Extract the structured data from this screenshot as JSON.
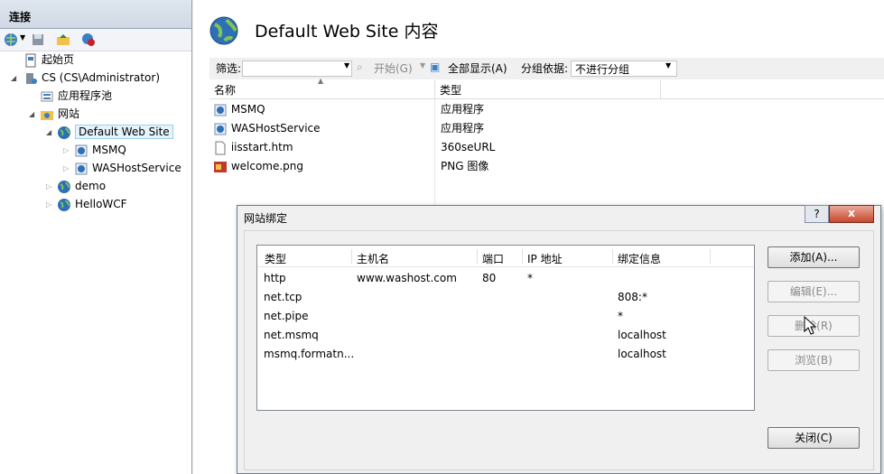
{
  "left": {
    "title": "连接",
    "tree": [
      {
        "label": "起始页",
        "icon": "start-page-icon"
      },
      {
        "label": "CS (CS\\Administrator)",
        "icon": "server-icon"
      },
      {
        "label": "应用程序池",
        "icon": "app-pool-icon"
      },
      {
        "label": "网站",
        "icon": "sites-folder-icon"
      },
      {
        "label": "Default Web Site",
        "icon": "globe-icon"
      },
      {
        "label": "MSMQ",
        "icon": "app-icon"
      },
      {
        "label": "WASHostService",
        "icon": "app-icon"
      },
      {
        "label": "demo",
        "icon": "globe-icon"
      },
      {
        "label": "HelloWCF",
        "icon": "globe-icon"
      }
    ]
  },
  "header": {
    "title": "Default Web Site 内容"
  },
  "filterbar": {
    "filter_label": "筛选:",
    "start_label": "开始(G)",
    "showall_label": "全部显示(A)",
    "groupby_label": "分组依据:",
    "groupby_value": "不进行分组"
  },
  "list": {
    "col_name": "名称",
    "col_type": "类型",
    "rows": [
      {
        "name": "MSMQ",
        "type": "应用程序"
      },
      {
        "name": "WASHostService",
        "type": "应用程序"
      },
      {
        "name": "iisstart.htm",
        "type": "360seURL"
      },
      {
        "name": "welcome.png",
        "type": "PNG 图像"
      }
    ]
  },
  "dialog": {
    "title": "网站绑定",
    "help": "?",
    "close": "x",
    "columns": [
      "类型",
      "主机名",
      "端口",
      "IP 地址",
      "绑定信息"
    ],
    "bindings": [
      {
        "type": "http",
        "host": "www.washost.com",
        "port": "80",
        "ip": "*",
        "info": ""
      },
      {
        "type": "net.tcp",
        "host": "",
        "port": "",
        "ip": "",
        "info": "808:*"
      },
      {
        "type": "net.pipe",
        "host": "",
        "port": "",
        "ip": "",
        "info": "*"
      },
      {
        "type": "net.msmq",
        "host": "",
        "port": "",
        "ip": "",
        "info": "localhost"
      },
      {
        "type": "msmq.formatn...",
        "host": "",
        "port": "",
        "ip": "",
        "info": "localhost"
      }
    ],
    "btn_add": "添加(A)...",
    "btn_edit": "编辑(E)...",
    "btn_remove": "删除(R)",
    "btn_browse": "浏览(B)",
    "btn_close": "关闭(C)"
  }
}
